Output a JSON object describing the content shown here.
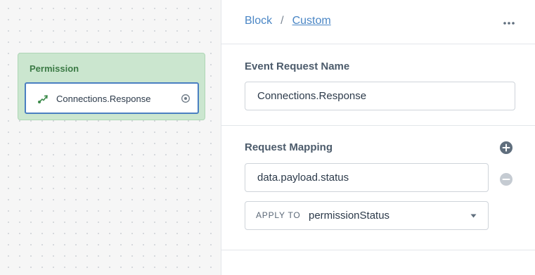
{
  "canvas": {
    "block": {
      "title": "Permission",
      "event": {
        "label": "Connections.Response",
        "icon": "route-arrow-icon",
        "target_icon": "radio-target-icon"
      }
    }
  },
  "panel": {
    "breadcrumb": {
      "parent": "Block",
      "separator": "/",
      "current": "Custom"
    },
    "more_icon": "ellipsis-icon",
    "event_request": {
      "label": "Event Request Name",
      "value": "Connections.Response"
    },
    "request_mapping": {
      "label": "Request Mapping",
      "add_icon": "plus-circle-icon",
      "remove_icon": "minus-circle-icon",
      "path_value": "data.payload.status",
      "apply_to_label": "APPLY TO",
      "apply_to_value": "permissionStatus"
    }
  },
  "colors": {
    "block_bg": "#cbe6cf",
    "block_title": "#3b7a45",
    "chip_border": "#4a7fc1",
    "link": "#4a86c5",
    "icon_dark": "#5f6e7d",
    "icon_light": "#c5cbd2"
  }
}
